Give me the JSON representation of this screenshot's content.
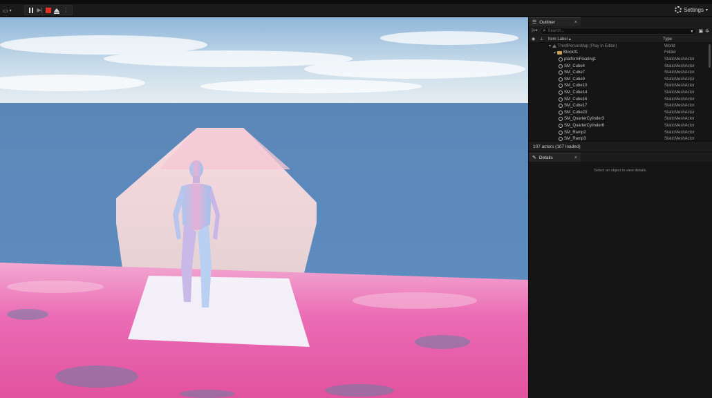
{
  "toolbar": {
    "left_icon": "camera-speed-icon",
    "settings_label": "Settings"
  },
  "outliner": {
    "tab_label": "Outliner",
    "search_placeholder": "Search...",
    "col_label": "Item Label",
    "col_type": "Type",
    "rows": [
      {
        "label": "ThirdPersonMap (Play in Editor)",
        "type": "World",
        "indent": 1,
        "icon": "world-icon",
        "expand": true,
        "dim": true
      },
      {
        "label": "Block01",
        "type": "Folder",
        "indent": 2,
        "icon": "folder-icon",
        "expand": true
      },
      {
        "label": "platformFloating1",
        "type": "StaticMeshActor",
        "indent": 3,
        "icon": "static-mesh-icon"
      },
      {
        "label": "SM_Cube4",
        "type": "StaticMeshActor",
        "indent": 3,
        "icon": "static-mesh-icon"
      },
      {
        "label": "SM_Cube7",
        "type": "StaticMeshActor",
        "indent": 3,
        "icon": "static-mesh-icon"
      },
      {
        "label": "SM_Cube9",
        "type": "StaticMeshActor",
        "indent": 3,
        "icon": "static-mesh-icon"
      },
      {
        "label": "SM_Cube10",
        "type": "StaticMeshActor",
        "indent": 3,
        "icon": "static-mesh-icon"
      },
      {
        "label": "SM_Cube14",
        "type": "StaticMeshActor",
        "indent": 3,
        "icon": "static-mesh-icon"
      },
      {
        "label": "SM_Cube16",
        "type": "StaticMeshActor",
        "indent": 3,
        "icon": "static-mesh-icon"
      },
      {
        "label": "SM_Cube17",
        "type": "StaticMeshActor",
        "indent": 3,
        "icon": "static-mesh-icon"
      },
      {
        "label": "SM_Cube20",
        "type": "StaticMeshActor",
        "indent": 3,
        "icon": "static-mesh-icon"
      },
      {
        "label": "SM_QuarterCylinder3",
        "type": "StaticMeshActor",
        "indent": 3,
        "icon": "static-mesh-icon"
      },
      {
        "label": "SM_QuarterCylinder6",
        "type": "StaticMeshActor",
        "indent": 3,
        "icon": "static-mesh-icon"
      },
      {
        "label": "SM_Ramp2",
        "type": "StaticMeshActor",
        "indent": 3,
        "icon": "static-mesh-icon"
      },
      {
        "label": "SM_Ramp3",
        "type": "StaticMeshActor",
        "indent": 3,
        "icon": "static-mesh-icon"
      }
    ],
    "status": "107 actors (107 loaded)"
  },
  "details": {
    "tab_label": "Details",
    "empty_text": "Select an object to view details."
  },
  "colors": {
    "stop": "#e0312a",
    "panel_bg": "#151515",
    "floor_pink": "#e85fae"
  }
}
